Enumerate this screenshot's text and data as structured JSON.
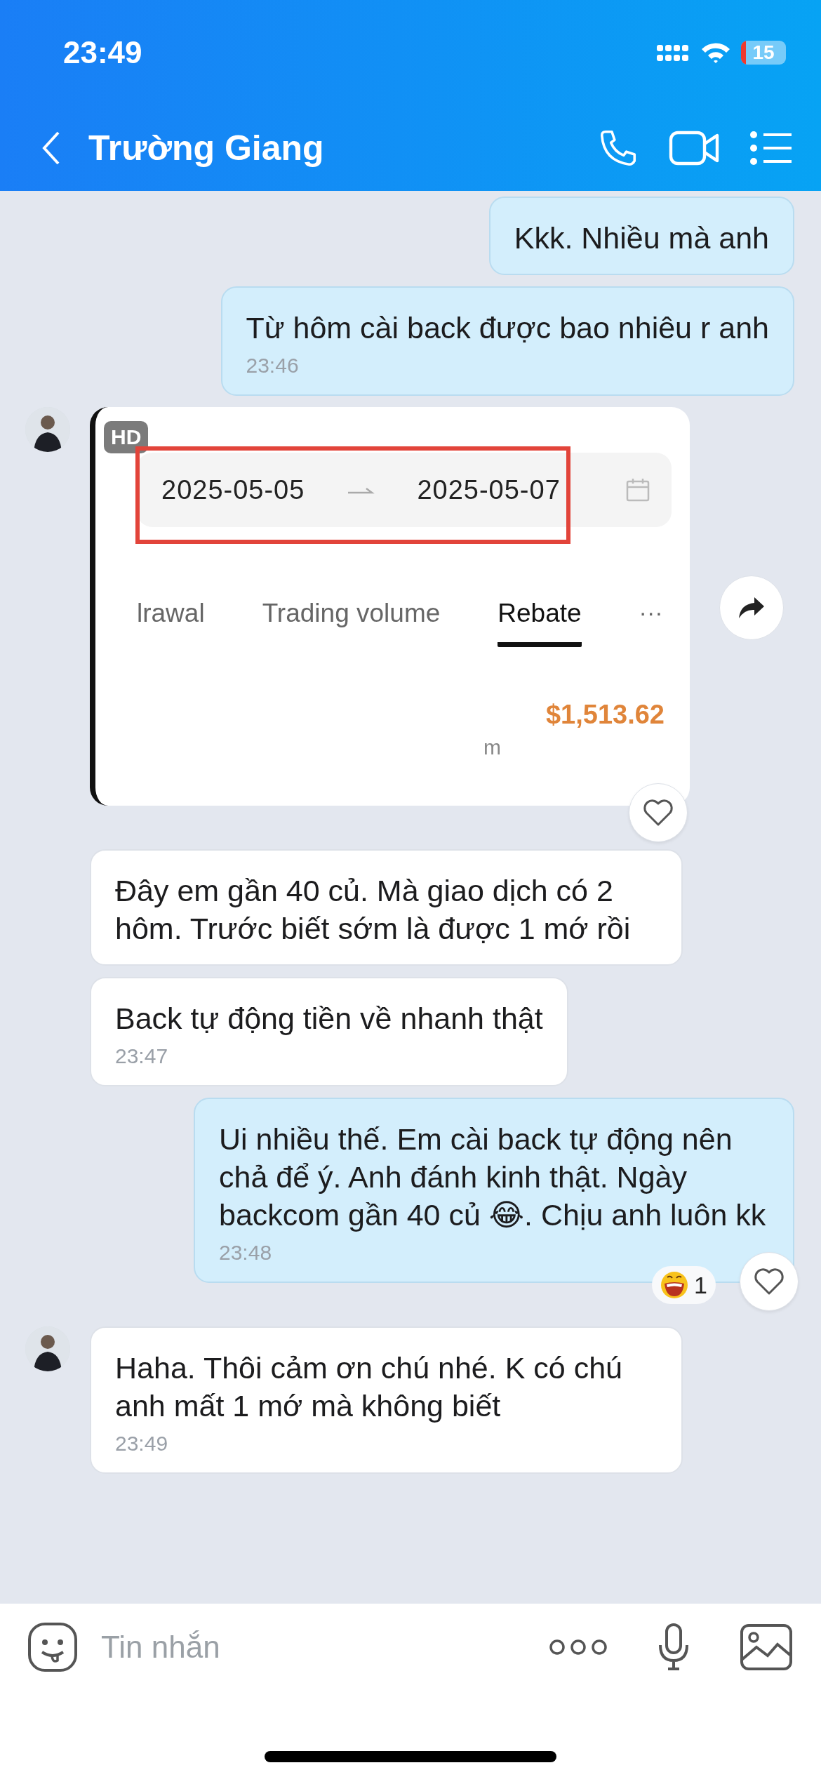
{
  "status_bar": {
    "time": "23:49",
    "battery": "15"
  },
  "header": {
    "title": "Trường Giang"
  },
  "messages": [
    {
      "kind": "text",
      "outgoing": true,
      "text": "Kkk. Nhiều mà anh"
    },
    {
      "kind": "text",
      "outgoing": true,
      "text": "Từ hôm cài back được bao nhiêu r anh",
      "time": "23:46"
    },
    {
      "kind": "image",
      "outgoing": false,
      "avatar": true,
      "like_button": true,
      "badge": "HD",
      "date_from": "2025-05-05",
      "date_to": "2025-05-07",
      "tabs": [
        {
          "label": "lrawal",
          "selected": false
        },
        {
          "label": "Trading volume",
          "selected": false
        },
        {
          "label": "Rebate",
          "selected": true
        }
      ],
      "more": "···",
      "amount": "$1,513.62",
      "fragment": "m"
    },
    {
      "kind": "text",
      "outgoing": false,
      "text": "Đây em gần 40 củ. Mà giao dịch có 2 hôm. Trước biết sớm là được 1 mớ rồi"
    },
    {
      "kind": "text",
      "outgoing": false,
      "text": "Back tự động tiền về nhanh thật",
      "time": "23:47"
    },
    {
      "kind": "text",
      "outgoing": true,
      "text": "Ui nhiều thế. Em cài back tự động nên chả để ý. Anh đánh kinh thật. Ngày backcom gần 40 củ 😂. Chịu anh luôn kk",
      "time": "23:48",
      "like_button": true,
      "reaction_count": "1"
    },
    {
      "kind": "text",
      "outgoing": false,
      "avatar": true,
      "text": "Haha. Thôi cảm ơn chú nhé. K có chú anh mất 1 mớ mà không biết",
      "time": "23:49"
    }
  ],
  "composer": {
    "placeholder": "Tin nhắn"
  }
}
